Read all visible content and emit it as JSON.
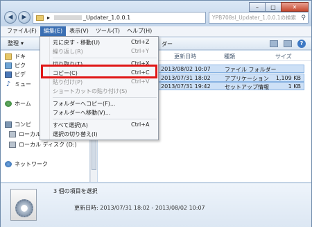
{
  "window": {
    "address_suffix": "_Updater_1.0.0.1",
    "search_placeholder": "YPB708sl_Updater_1.0.0.1の検索",
    "minimize": "–",
    "maximize": "□",
    "close": "✕"
  },
  "menubar": [
    {
      "label": "ファイル(F)"
    },
    {
      "label": "編集(E)"
    },
    {
      "label": "表示(V)"
    },
    {
      "label": "ツール(T)"
    },
    {
      "label": "ヘルプ(H)"
    }
  ],
  "toolbar": {
    "organize": "整理",
    "organize_arrow": "▾",
    "folder_tail": "ダー"
  },
  "nav": {
    "documents": "ドキ",
    "pictures": "ピク",
    "videos": "ビデ",
    "music": "ミュー",
    "homegroup": "ホーム",
    "computer": "コンピ",
    "local_c": "ローカル",
    "local_d": "ローカル ディスク (D:)",
    "network": "ネットワーク"
  },
  "columns": {
    "modified": "更新日時",
    "type": "種類",
    "size": "サイズ"
  },
  "files": [
    {
      "modified": "2013/08/02 10:07",
      "type": "ファイル フォルダー",
      "size": ""
    },
    {
      "modified": "2013/07/31 18:02",
      "type": "アプリケーション",
      "size": "1,109 KB"
    },
    {
      "modified": "2013/07/31 19:42",
      "type": "セットアップ情報",
      "size": "1 KB"
    }
  ],
  "menu_items": [
    {
      "label": "元に戻す - 移動(U)",
      "shortcut": "Ctrl+Z",
      "disabled": false
    },
    {
      "label": "繰り返し(R)",
      "shortcut": "Ctrl+Y",
      "disabled": true
    },
    {
      "label": "切り取り(T)",
      "shortcut": "Ctrl+X",
      "disabled": false
    },
    {
      "label": "コピー(C)",
      "shortcut": "Ctrl+C",
      "disabled": false
    },
    {
      "label": "貼り付け(P)",
      "shortcut": "Ctrl+V",
      "disabled": true
    },
    {
      "label": "ショートカットの貼り付け(S)",
      "shortcut": "",
      "disabled": true
    },
    {
      "label": "フォルダーへコピー(F)...",
      "shortcut": "",
      "disabled": false
    },
    {
      "label": "フォルダーへ移動(V)...",
      "shortcut": "",
      "disabled": false
    },
    {
      "label": "すべて選択(A)",
      "shortcut": "Ctrl+A",
      "disabled": false
    },
    {
      "label": "選択の切り替え(I)",
      "shortcut": "",
      "disabled": false
    }
  ],
  "details": {
    "title": "3 個の項目を選択",
    "date": "更新日時: 2013/07/31 18:02 - 2013/08/02 10:07"
  },
  "colors": {
    "accent": "#3b6fb3",
    "highlight_box": "#e01616",
    "selection": "#cde0f6"
  }
}
